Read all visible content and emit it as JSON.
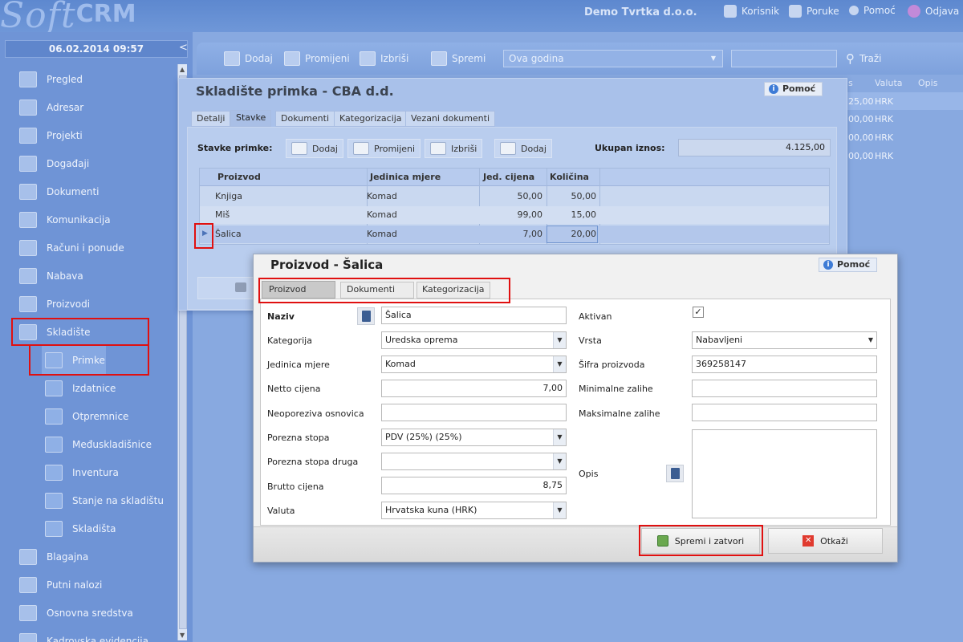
{
  "app": {
    "logo_a": "Soft",
    "logo_b": "CRM",
    "company": "Demo Tvrtka d.o.o.",
    "datetime": "06.02.2014 09:57",
    "collapse": "<"
  },
  "topnav": [
    {
      "label": "Korisnik",
      "icon": "user-icon"
    },
    {
      "label": "Poruke",
      "icon": "messages-icon"
    },
    {
      "label": "Pomoć",
      "icon": "help-icon"
    },
    {
      "label": "Odjava",
      "icon": "logout-icon"
    }
  ],
  "sidebar": {
    "items": [
      {
        "label": "Pregled",
        "icon": "overview-icon"
      },
      {
        "label": "Adresar",
        "icon": "address-book-icon"
      },
      {
        "label": "Projekti",
        "icon": "projects-icon"
      },
      {
        "label": "Događaji",
        "icon": "calendar-icon"
      },
      {
        "label": "Dokumenti",
        "icon": "documents-icon"
      },
      {
        "label": "Komunikacija",
        "icon": "communication-icon"
      },
      {
        "label": "Računi i ponude",
        "icon": "invoice-icon"
      },
      {
        "label": "Nabava",
        "icon": "procurement-icon"
      },
      {
        "label": "Proizvodi",
        "icon": "products-icon"
      },
      {
        "label": "Skladište",
        "icon": "warehouse-icon"
      }
    ],
    "subitems": [
      {
        "label": "Primke",
        "icon": "receipt-icon"
      },
      {
        "label": "Izdatnice",
        "icon": "issue-icon"
      },
      {
        "label": "Otpremnice",
        "icon": "delivery-icon"
      },
      {
        "label": "Međuskladišnice",
        "icon": "transfer-icon"
      },
      {
        "label": "Inventura",
        "icon": "inventory-icon"
      },
      {
        "label": "Stanje na skladištu",
        "icon": "stock-icon"
      },
      {
        "label": "Skladišta",
        "icon": "warehouses-icon"
      }
    ],
    "items_after": [
      {
        "label": "Blagajna",
        "icon": "cash-register-icon"
      },
      {
        "label": "Putni nalozi",
        "icon": "travel-order-icon"
      },
      {
        "label": "Osnovna sredstva",
        "icon": "assets-icon"
      },
      {
        "label": "Kadrovska evidencija",
        "icon": "hr-icon"
      }
    ]
  },
  "maintoolbar": {
    "dodaj": "Dodaj",
    "promijeni": "Promijeni",
    "izbrisi": "Izbriši",
    "spremi": "Spremi",
    "period": "Ova godina",
    "search_label": "Traži"
  },
  "bggrid": {
    "headers": [
      "s",
      "Valuta",
      "Opis"
    ],
    "rows": [
      [
        "25,00",
        "HRK"
      ],
      [
        "00,00",
        "HRK"
      ],
      [
        "00,00",
        "HRK"
      ],
      [
        "00,00",
        "HRK"
      ]
    ]
  },
  "win1": {
    "title": "Skladište primka - CBA d.d.",
    "help": "Pomoć",
    "tabs": [
      "Detalji",
      "Stavke",
      "Dokumenti",
      "Kategorizacija",
      "Vezani dokumenti"
    ],
    "stavke_label": "Stavke primke:",
    "buttons": [
      "Dodaj",
      "Promijeni",
      "Izbriši",
      "Dodaj"
    ],
    "ukupan_label": "Ukupan iznos:",
    "ukupan_value": "4.125,00",
    "columns": [
      "Proizvod",
      "Jedinica mjere",
      "Jed. cijena",
      "Količina"
    ],
    "rows": [
      [
        "Knjiga",
        "Komad",
        "50,00",
        "50,00"
      ],
      [
        "Miš",
        "Komad",
        "99,00",
        "15,00"
      ],
      [
        "Šalica",
        "Komad",
        "7,00",
        "20,00"
      ]
    ]
  },
  "win2": {
    "title": "Proizvod - Šalica",
    "help": "Pomoć",
    "tabs": [
      "Proizvod",
      "Dokumenti",
      "Kategorizacija"
    ],
    "left": {
      "naziv": {
        "label": "Naziv",
        "value": "Šalica"
      },
      "kategorija": {
        "label": "Kategorija",
        "value": "Uredska oprema"
      },
      "jedinica": {
        "label": "Jedinica mjere",
        "value": "Komad"
      },
      "netto": {
        "label": "Netto cijena",
        "value": "7,00"
      },
      "neoporeziva": {
        "label": "Neoporeziva osnovica",
        "value": ""
      },
      "porezna": {
        "label": "Porezna stopa",
        "value": "PDV (25%) (25%)"
      },
      "porezna2": {
        "label": "Porezna stopa druga",
        "value": ""
      },
      "brutto": {
        "label": "Brutto cijena",
        "value": "8,75"
      },
      "valuta": {
        "label": "Valuta",
        "value": "Hrvatska kuna (HRK)"
      }
    },
    "right": {
      "aktivan": {
        "label": "Aktivan",
        "checked": "✓"
      },
      "vrsta": {
        "label": "Vrsta",
        "value": "Nabavljeni"
      },
      "sifra": {
        "label": "Šifra proizvoda",
        "value": "369258147"
      },
      "minzal": {
        "label": "Minimalne zalihe",
        "value": ""
      },
      "maxzal": {
        "label": "Maksimalne zalihe",
        "value": ""
      },
      "opis": {
        "label": "Opis",
        "value": ""
      }
    },
    "save_close": "Spremi i zatvori",
    "cancel": "Otkaži"
  },
  "colors": {
    "accent_red": "#e01010",
    "sidebar_bg": "#6f94d6",
    "panel_bg": "#88a9e0"
  }
}
